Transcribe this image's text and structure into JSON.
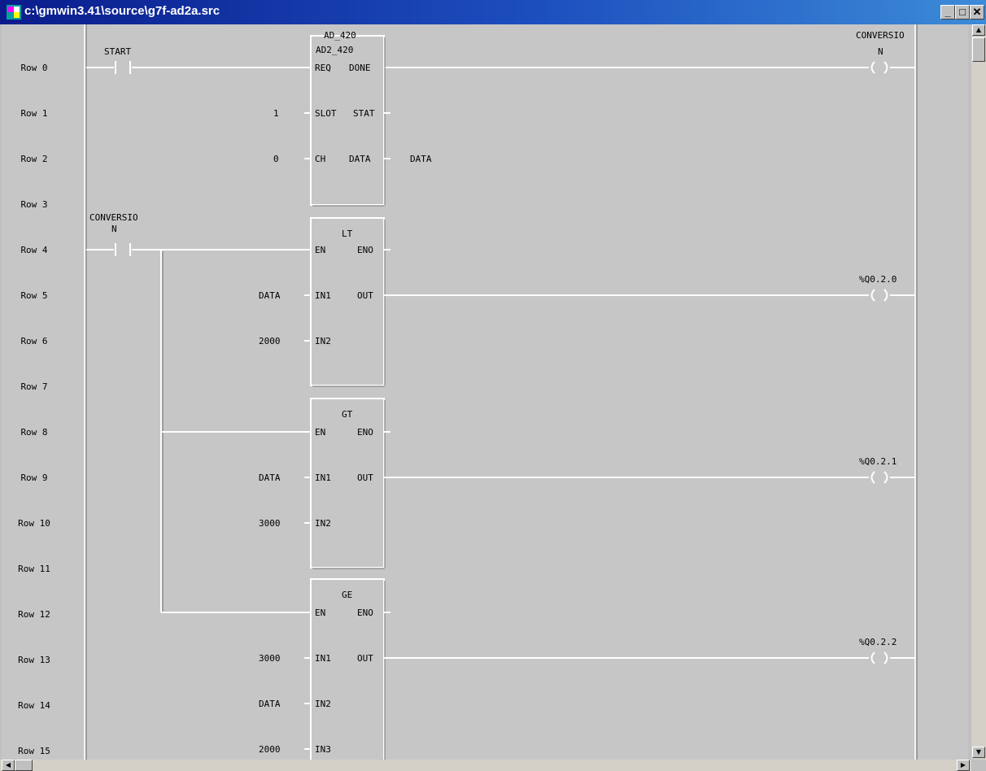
{
  "window": {
    "title": "c:\\gmwin3.41\\source\\g7f-ad2a.src",
    "buttons": {
      "minimize": "_",
      "maximize": "□",
      "close": "✕"
    }
  },
  "rows": [
    "Row 0",
    "Row 1",
    "Row 2",
    "Row 3",
    "Row 4",
    "Row 5",
    "Row 6",
    "Row 7",
    "Row 8",
    "Row 9",
    "Row 10",
    "Row 11",
    "Row 12",
    "Row 13",
    "Row 14",
    "Row 15"
  ],
  "contacts": {
    "start": "START",
    "conversion_line1": "CONVERSIO",
    "conversion_line2": "N"
  },
  "blocks": {
    "ad": {
      "type": "AD_420",
      "instance": "AD2_420",
      "pins": {
        "req": "REQ",
        "done": "DONE",
        "slot": "SLOT",
        "stat": "STAT",
        "ch": "CH",
        "data": "DATA"
      },
      "inputs": {
        "slot": "1",
        "ch": "0"
      },
      "output_data": "DATA"
    },
    "lt": {
      "type": "LT",
      "en": "EN",
      "eno": "ENO",
      "in1": "IN1",
      "in2": "IN2",
      "out": "OUT",
      "in1_val": "DATA",
      "in2_val": "2000"
    },
    "gt": {
      "type": "GT",
      "en": "EN",
      "eno": "ENO",
      "in1": "IN1",
      "in2": "IN2",
      "out": "OUT",
      "in1_val": "DATA",
      "in2_val": "3000"
    },
    "ge": {
      "type": "GE",
      "en": "EN",
      "eno": "ENO",
      "in1": "IN1",
      "in2": "IN2",
      "in3": "IN3",
      "out": "OUT",
      "in1_val": "3000",
      "in2_val": "DATA",
      "in3_val": "2000"
    }
  },
  "coils": {
    "conversion_line1": "CONVERSIO",
    "conversion_line2": "N",
    "q0": "%Q0.2.0",
    "q1": "%Q0.2.1",
    "q2": "%Q0.2.2"
  }
}
